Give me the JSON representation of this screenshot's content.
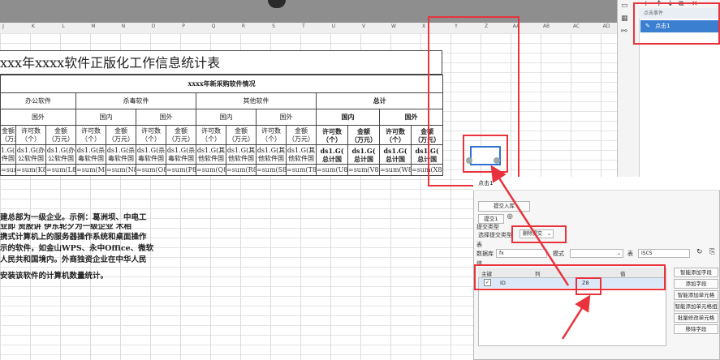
{
  "columns": [
    "J",
    "K",
    "L",
    "M",
    "N",
    "O",
    "P",
    "Q",
    "R",
    "S",
    "T",
    "U",
    "V",
    "W",
    "X",
    "Y",
    "Z",
    "AA",
    "AB",
    "AC",
    "AD"
  ],
  "report": {
    "title": "xxx年xxxx软件正版化工作信息统计表",
    "subtitle": "xxxx年新采购软件情况",
    "groups": {
      "office": "办公软件",
      "antivirus": "杀毒软件",
      "other": "其他软件",
      "total": "总计"
    },
    "sub": {
      "domestic": "国内",
      "foreign": "国外",
      "domestic_b": "国内",
      "foreign_b": "国外"
    },
    "head_cells": [
      [
        "金额",
        "（万元）"
      ],
      [
        "许可数",
        "（个）"
      ],
      [
        "金额",
        "（万元）"
      ],
      [
        "许可数",
        "（个）"
      ],
      [
        "金额",
        "（万元）"
      ],
      [
        "许可数",
        "（个）"
      ],
      [
        "金额",
        "（万元）"
      ],
      [
        "许可数",
        "（个）"
      ],
      [
        "金额",
        "（万元）"
      ],
      [
        "许可数",
        "（个）"
      ],
      [
        "金额",
        "（万元）"
      ],
      [
        "许可数",
        "（个）"
      ],
      [
        "金额",
        "（万元）"
      ],
      [
        "许可数",
        "（个）"
      ],
      [
        "金额",
        "（万元）"
      ]
    ],
    "data_cells": [
      [
        "1.G(办",
        "件国"
      ],
      [
        "ds1.G(办",
        "公软件国"
      ],
      [
        "ds1.G(办",
        "公软件国"
      ],
      [
        "ds1.G(杀",
        "毒软件国"
      ],
      [
        "ds1.G(杀",
        "毒软件国"
      ],
      [
        "ds1.G(杀",
        "毒软件国"
      ],
      [
        "ds1.G(杀",
        "毒软件国"
      ],
      [
        "ds1.G(其",
        "他软件国"
      ],
      [
        "ds1.G(其",
        "他软件国"
      ],
      [
        "ds1.G(其",
        "他软件国"
      ],
      [
        "ds1.G(其",
        "他软件国"
      ],
      [
        "ds1.G(",
        "总计国"
      ],
      [
        "ds1.G(",
        "总计国"
      ],
      [
        "ds1.G(",
        "总计国"
      ],
      [
        "ds1.G(",
        "总计国"
      ]
    ],
    "formulas": [
      "=sum(J8)",
      "=sum(K8)",
      "=sum(L8)",
      "=sum(M8)",
      "=sum(N8)",
      "=sum(O8)",
      "=sum(P8)",
      "=sum(Q8)",
      "=sum(R8)",
      "=sum(S8)",
      "=sum(T8)",
      "=sum(U8)",
      "=sum(V8)",
      "=sum(W8)",
      "=sum(X8)"
    ],
    "paragraph": [
      "建总部为一级企业。示例：葛洲坝、中电工",
      "   业即    资股讲    伊东轮夕为一级企业    木相",
      "携式计算机上的服务器操作系统和桌面操作",
      "示的软件，如金山WPS、永中Office、微软",
      "人民共和国境内。外商独资企业在中华人民",
      "",
      "安装该软件的计算机数量统计。"
    ]
  },
  "events_panel": {
    "header": "点击事件",
    "item": "点击1"
  },
  "dialog": {
    "title": "点击1",
    "submit_to_db": "提交入库",
    "submit_btn": "提交1",
    "submit_category": "提交类型",
    "select_type_label": "选择提交类型",
    "type_value": "删除提交",
    "table_label": "表",
    "database_label": "数据库",
    "database_value": "fx",
    "mode_label": "模式",
    "table_field_label": "表",
    "table_value": "ISCS",
    "value_label": "值",
    "col_headers": {
      "key": "主键",
      "column": "列",
      "value": "值"
    },
    "row": {
      "column": "ID",
      "value": "Z8"
    },
    "side_buttons": [
      "智能添加字段",
      "添加字段",
      "智能添加单元格",
      "智能添加单元格组",
      "批量修改单元格",
      "移除字段"
    ]
  },
  "colors": {
    "highlight": "#e8333c",
    "selection": "#2f74d0",
    "event_selected": "#3b7fd0"
  }
}
